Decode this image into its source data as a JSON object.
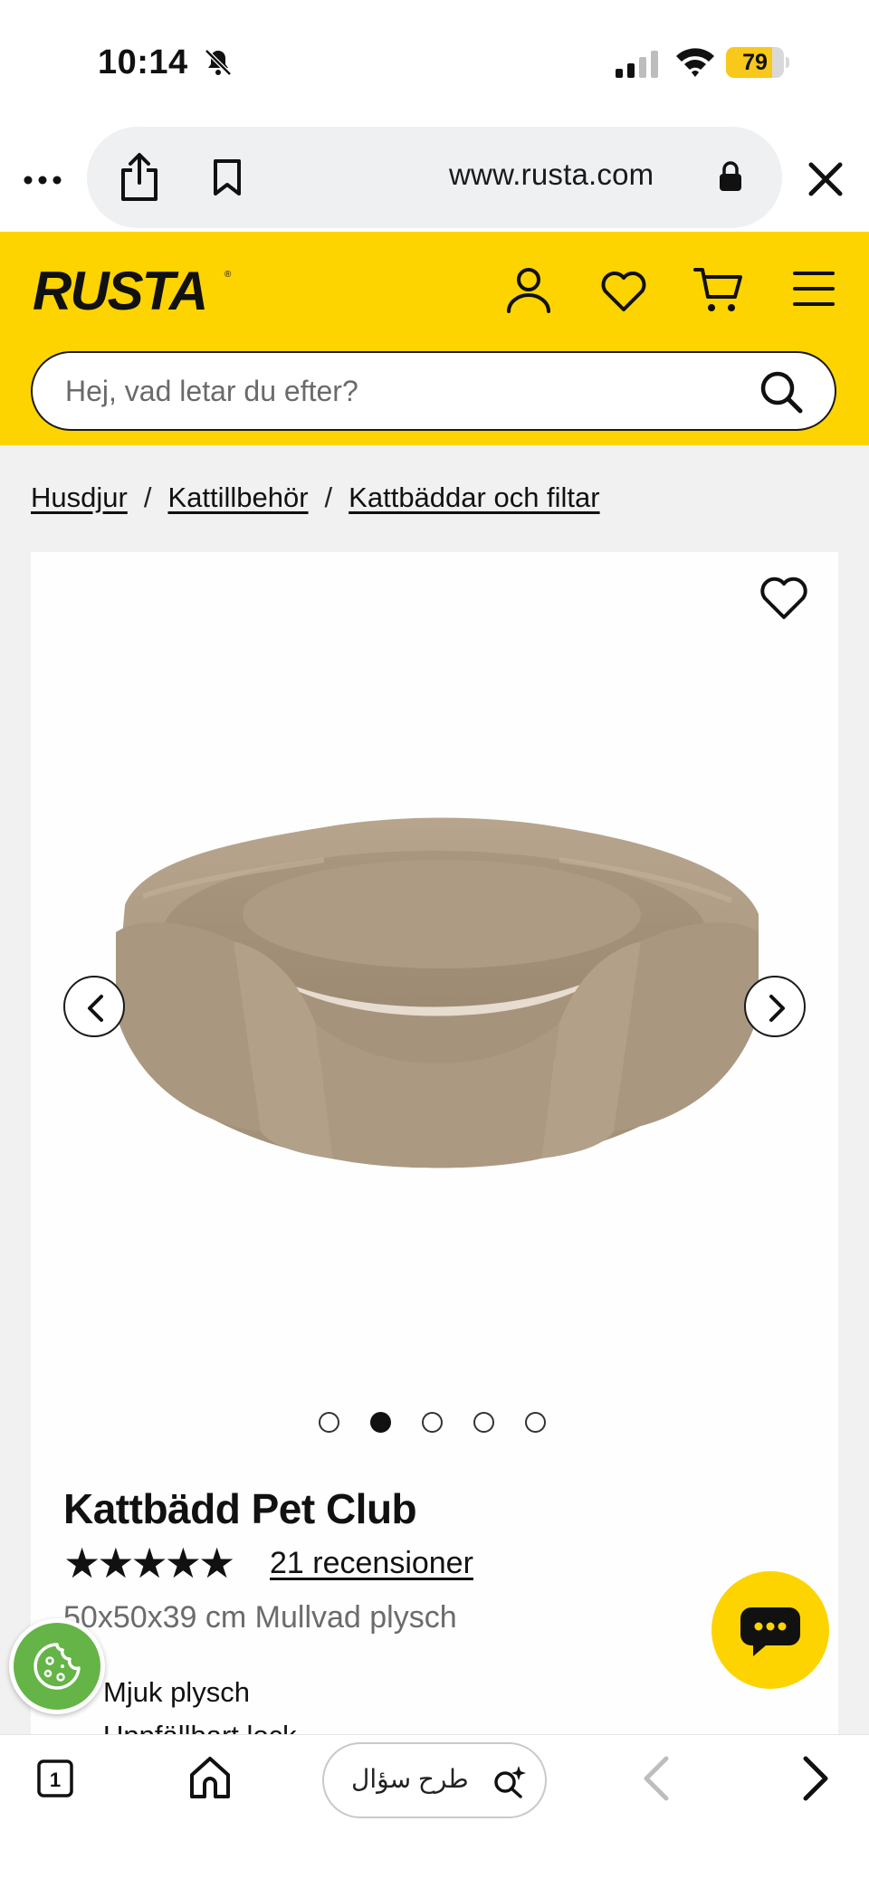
{
  "status_bar": {
    "time": "10:14",
    "battery_level": 79,
    "battery_label": "79"
  },
  "browser": {
    "url": "www.rusta.com",
    "icons": [
      "more-icon",
      "share-icon",
      "bookmark-icon",
      "lock-icon",
      "close-icon"
    ]
  },
  "site_header": {
    "logo_text": "RUSTA",
    "search_placeholder": "Hej, vad letar du efter?",
    "icons": [
      "user-icon",
      "heart-icon",
      "cart-icon",
      "menu-icon",
      "search-icon"
    ],
    "brand_color": "#fdd400"
  },
  "breadcrumb": {
    "items": [
      "Husdjur",
      "Kattillbehör",
      "Kattbäddar och filtar"
    ],
    "separator": "/"
  },
  "product": {
    "title": "Kattbädd Pet Club",
    "rating": 4.5,
    "stars_max": 5,
    "reviews_text": "21 recensioner",
    "variant": "50x50x39 cm Mullvad plysch",
    "features": [
      "Mjuk plysch",
      "Uppfällbart lock"
    ],
    "gallery": {
      "image_count": 5,
      "active_index": 1
    }
  },
  "bottom_toolbar": {
    "tab_count": "1",
    "ask_label": "طرح سؤال"
  },
  "colors": {
    "accent": "#fdd400",
    "cookie": "#65b447",
    "page_bg": "#f1f1f1"
  }
}
